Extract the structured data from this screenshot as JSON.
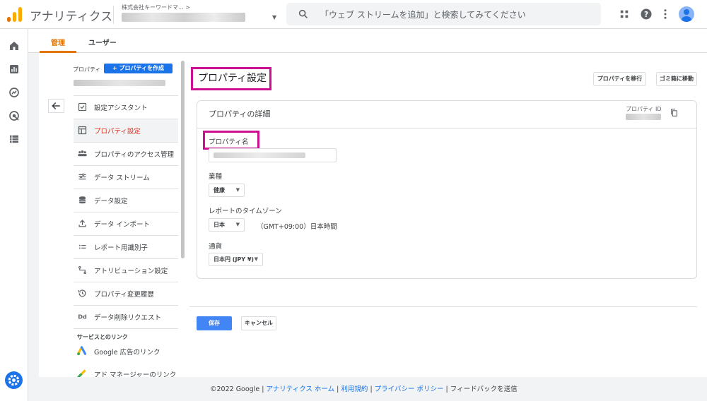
{
  "app": {
    "title": "アナリティクス",
    "account_label": "株式会社キーワードマ...",
    "account_chevron": ">",
    "search_placeholder": "「ウェブ ストリームを追加」と検索してみてください",
    "brand_color": "#f9ab00",
    "accent_color": "#1a73e8",
    "highlight_color": "#cc0f8f"
  },
  "tabs": [
    {
      "label": "管理",
      "active": true
    },
    {
      "label": "ユーザー",
      "active": false
    }
  ],
  "sidebar": {
    "column_label": "プロパティ",
    "create_button": "+ プロパティを作成",
    "items": [
      {
        "label": "設定アシスタント",
        "icon": "checklist-icon"
      },
      {
        "label": "プロパティ設定",
        "icon": "layout-icon",
        "active": true
      },
      {
        "label": "プロパティのアクセス管理",
        "icon": "people-icon"
      },
      {
        "label": "データ ストリーム",
        "icon": "stream-icon"
      },
      {
        "label": "データ設定",
        "icon": "database-icon"
      },
      {
        "label": "データ インポート",
        "icon": "upload-icon"
      },
      {
        "label": "レポート用識別子",
        "icon": "identifier-icon"
      },
      {
        "label": "アトリビューション設定",
        "icon": "attribution-icon"
      },
      {
        "label": "プロパティ変更履歴",
        "icon": "history-icon"
      },
      {
        "label": "データ削除リクエスト",
        "icon": "dd-icon"
      }
    ],
    "links_section": "サービスとのリンク",
    "links": [
      {
        "label": "Google 広告のリンク",
        "icon": "google-ads-icon"
      },
      {
        "label": "アド マネージャーのリンク",
        "icon": "ad-manager-icon"
      }
    ]
  },
  "page": {
    "title": "プロパティ設定",
    "move_button": "プロパティを移行",
    "trash_button": "ゴミ箱に移動"
  },
  "card": {
    "title": "プロパティの詳細",
    "property_id_label": "プロパティ ID",
    "name_label": "プロパティ名",
    "industry_label": "業種",
    "industry_value": "健康",
    "timezone_label": "レポートのタイムゾーン",
    "timezone_country": "日本",
    "timezone_value": "（GMT+09:00）日本時間",
    "currency_label": "通貨",
    "currency_value": "日本円 (JPY ¥)"
  },
  "actions": {
    "save": "保存",
    "cancel": "キャンセル"
  },
  "footer": {
    "copyright": "©2022 Google",
    "sep": " | ",
    "home": "アナリティクス ホーム",
    "terms": "利用規約",
    "privacy": "プライバシー ポリシー",
    "feedback": "フィードバックを送信"
  }
}
